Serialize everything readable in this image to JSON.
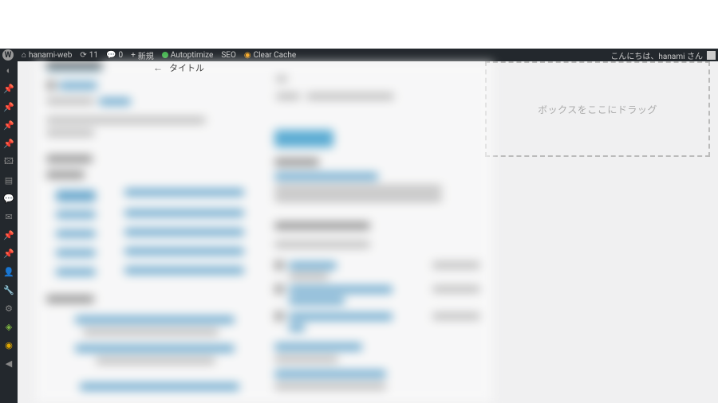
{
  "toolbar": {
    "site_name": "hanami-web",
    "updates_count": "11",
    "comments_count": "0",
    "new_label": "新規",
    "autoptimize_label": "Autoptimize",
    "seo_label": "SEO",
    "clear_cache_label": "Clear Cache",
    "greeting": "こんにちは、hanami さん"
  },
  "tabs": {
    "arrow": "←",
    "title_label": "タイトル"
  },
  "dropzone": {
    "text": "ボックスをここにドラッグ"
  }
}
